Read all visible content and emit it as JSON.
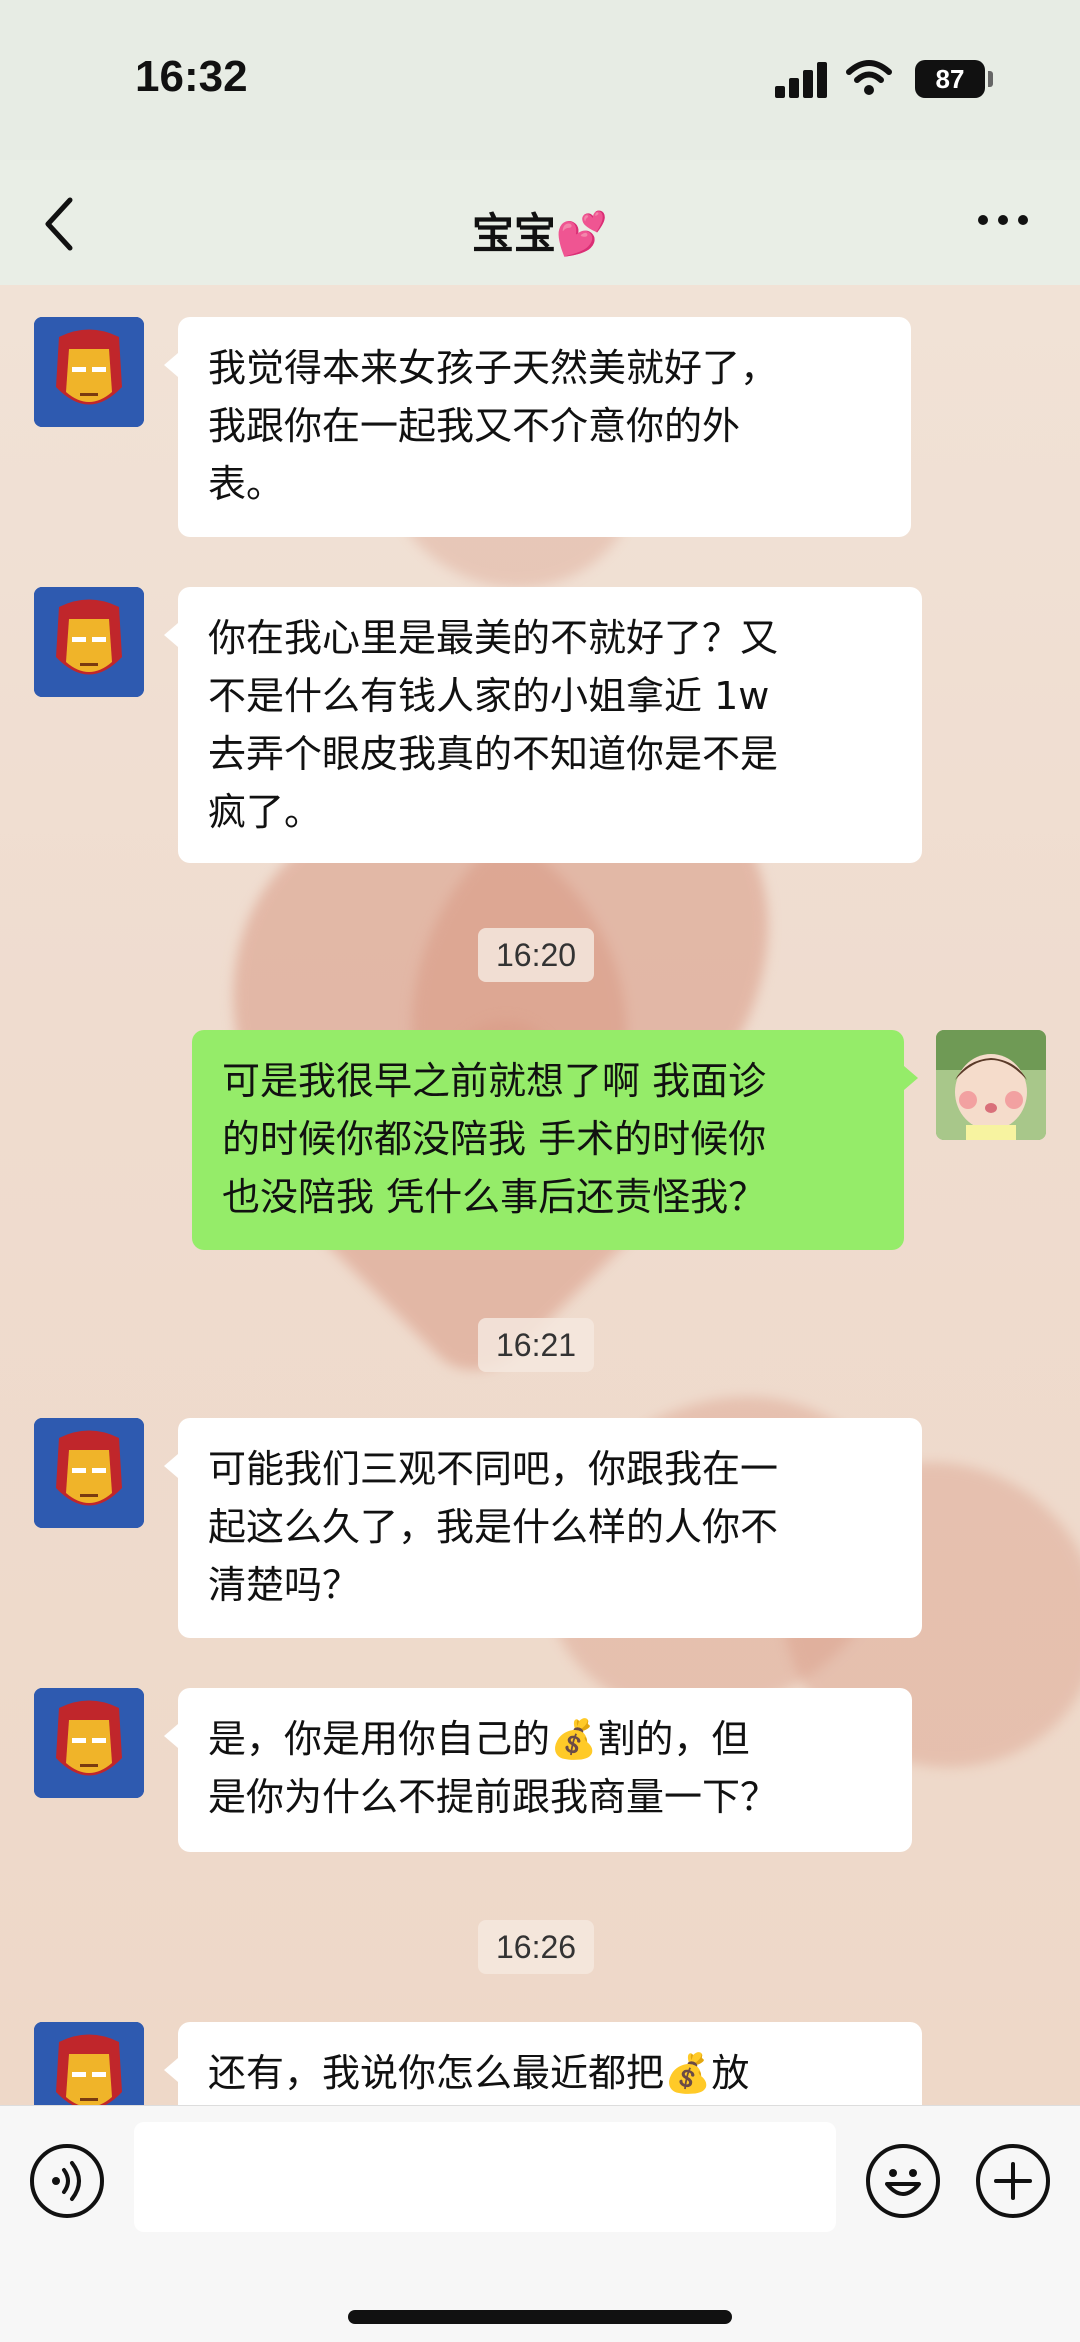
{
  "status_bar": {
    "time": "16:32",
    "battery": "87"
  },
  "header": {
    "title": "宝宝",
    "title_emoji": "💕",
    "back_icon": "chevron-left-icon",
    "more_icon": "more-dots-icon"
  },
  "messages": [
    {
      "side": "left",
      "text": "我觉得本来女孩子天然美就好了，\n我跟你在一起我又不介意你的外\n表。"
    },
    {
      "side": "left",
      "text": "你在我心里是最美的不就好了？又\n不是什么有钱人家的小姐拿近 1w\n去弄个眼皮我真的不知道你是不是\n疯了。"
    },
    {
      "side": "time",
      "text": "16:20"
    },
    {
      "side": "right",
      "text": "可是我很早之前就想了啊 我面诊\n的时候你都没陪我 手术的时候你\n也没陪我 凭什么事后还责怪我？"
    },
    {
      "side": "time",
      "text": "16:21"
    },
    {
      "side": "left",
      "text": "可能我们三观不同吧，你跟我在一\n起这么久了，我是什么样的人你不\n清楚吗？"
    },
    {
      "side": "left",
      "text": "是，你是用你自己的💰割的，但\n是你为什么不提前跟我商量一下？"
    },
    {
      "side": "time",
      "text": "16:26"
    },
    {
      "side": "left",
      "text": "还有，我说你怎么最近都把💰放"
    }
  ],
  "input_bar": {
    "placeholder": "",
    "voice_icon": "voice-icon",
    "emoji_icon": "emoji-icon",
    "plus_icon": "plus-icon"
  },
  "colors": {
    "header_bg": "#e9eee6",
    "bubble_self": "#95ec69",
    "bubble_other": "#ffffff",
    "wallpaper": "#efdccf"
  }
}
